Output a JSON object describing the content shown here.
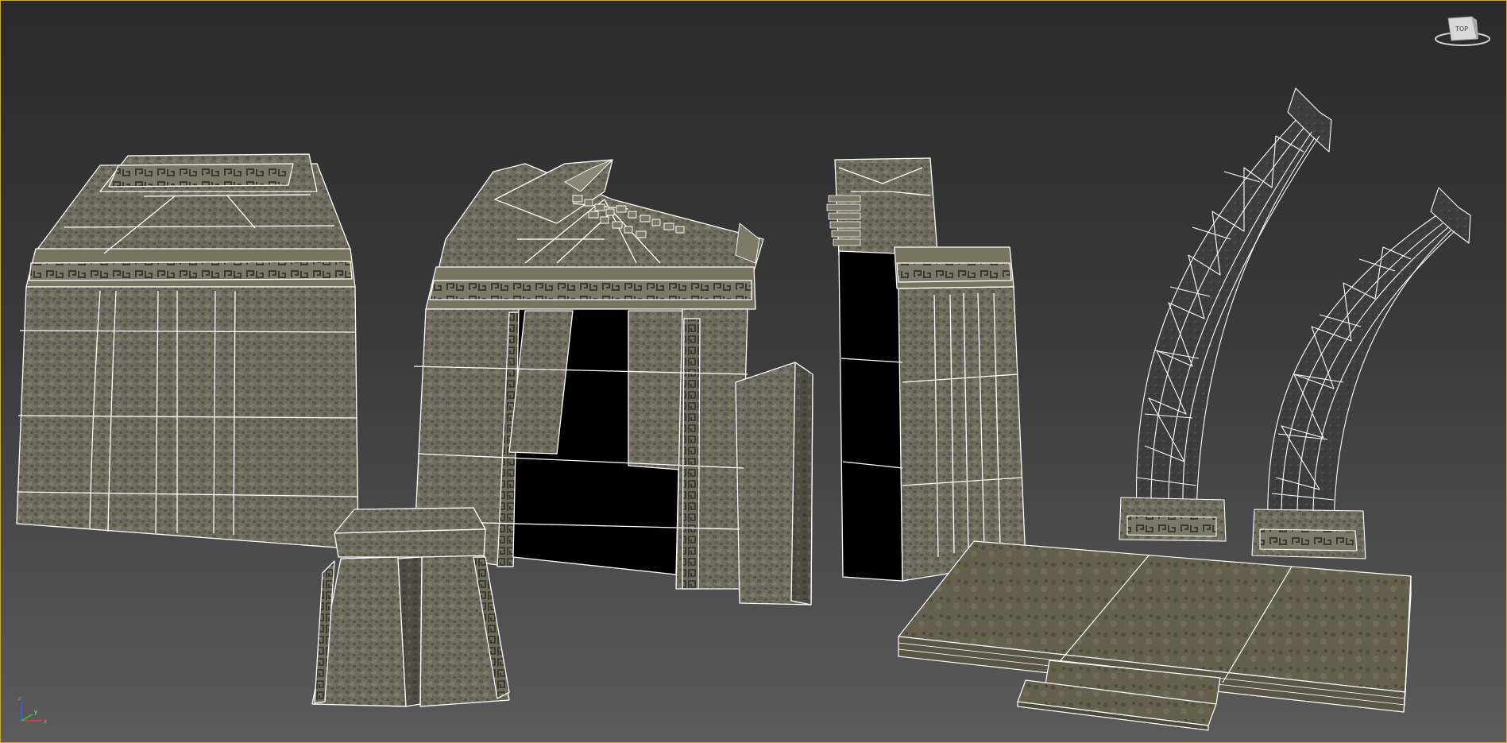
{
  "viewport": {
    "border_color": "#c9a640",
    "background_top": "#2a2a2a",
    "background_bottom": "#5b5b5b"
  },
  "viewcube": {
    "face_label": "TOP"
  },
  "axis_gizmo": {
    "x_label": "x",
    "y_label": "y",
    "z_label": "z"
  },
  "wire_color": "#ffffff",
  "stone_color": "#6f6e60",
  "shadow_color": "#000000"
}
